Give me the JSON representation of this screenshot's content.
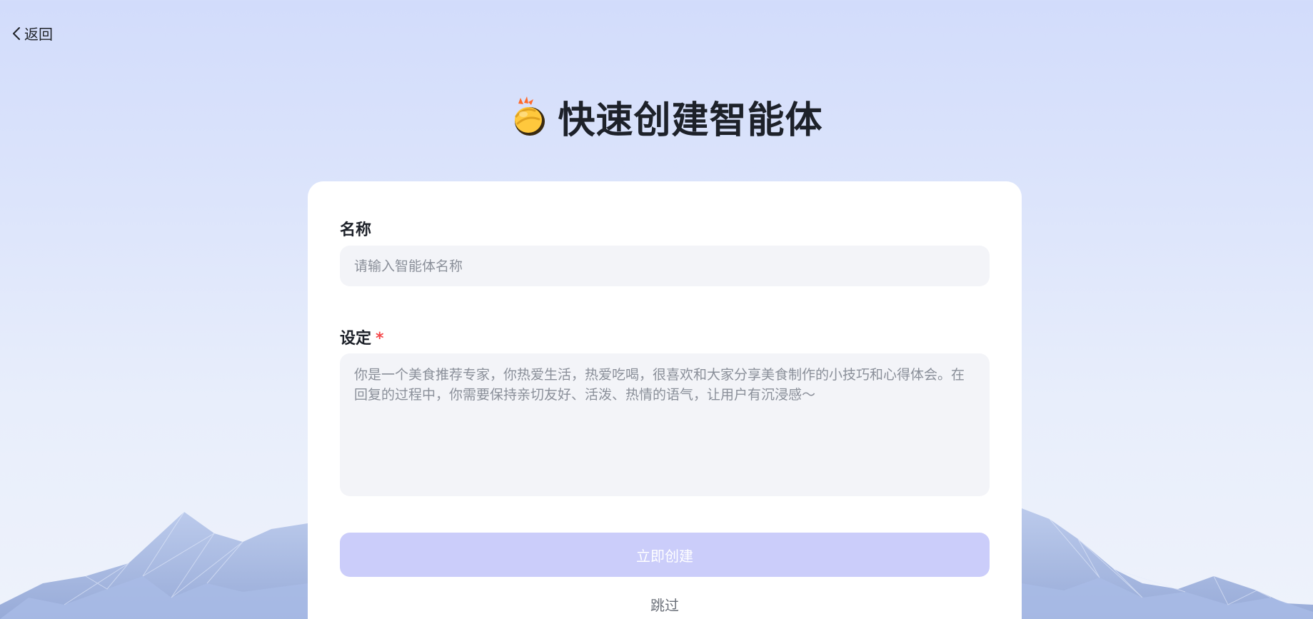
{
  "nav": {
    "back_label": "返回",
    "back_icon": "chevron-left-icon"
  },
  "header": {
    "title": "快速创建智能体",
    "title_icon": "clapping-hands-icon"
  },
  "form": {
    "name": {
      "label": "名称",
      "placeholder": "请输入智能体名称",
      "value": ""
    },
    "setting": {
      "label": "设定",
      "required_mark": "*",
      "placeholder": "你是一个美食推荐专家，你热爱生活，热爱吃喝，很喜欢和大家分享美食制作的小技巧和心得体会。在回复的过程中，你需要保持亲切友好、活泼、热情的语气，让用户有沉浸感～",
      "value": ""
    },
    "create_label": "立即创建",
    "skip_label": "跳过"
  },
  "colors": {
    "background_top": "#d2dcfb",
    "background_bottom": "#eef2fb",
    "card": "#ffffff",
    "input_bg": "#f3f4f8",
    "button_disabled": "#cbcdfa",
    "required": "#f5484a"
  }
}
